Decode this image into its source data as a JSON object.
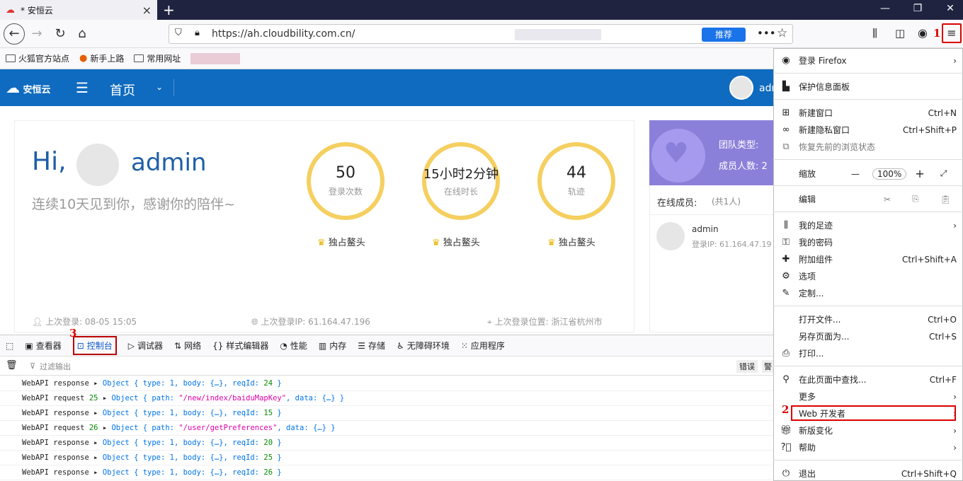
{
  "browser": {
    "tab_title": "* 安恒云",
    "url": "https://ah.cloudbility.com.cn/",
    "recommend_label": "推荐",
    "bookmarks": [
      "火狐官方站点",
      "新手上路",
      "常用网址"
    ]
  },
  "app": {
    "logo_text": "安恒云",
    "home_label": "首页",
    "top_user": "adr"
  },
  "dashboard": {
    "greeting": "Hi,",
    "username": "admin",
    "subline": "连续10天见到你，感谢你的陪伴~",
    "stats": [
      {
        "value": "50",
        "label": "登录次数",
        "badge": "独占鳌头"
      },
      {
        "value": "15小时2分钟",
        "label": "在线时长",
        "badge": "独占鳌头"
      },
      {
        "value": "44",
        "label": "轨迹",
        "badge": "独占鳌头"
      }
    ],
    "last_login": "上次登录:  08-05 15:05",
    "last_ip": "上次登录IP:  61.164.47.196",
    "last_location": "上次登录位置:  浙江省杭州市"
  },
  "team": {
    "type_label": "团队类型:",
    "members_label": "成员人数: 2",
    "online_label": "在线成员:",
    "online_count": "(共1人)",
    "member_name": "admin",
    "member_ip": "登录IP:  61.164.47.19"
  },
  "devtools": {
    "tabs": [
      "查看器",
      "控制台",
      "调试器",
      "网络",
      "样式编辑器",
      "性能",
      "内存",
      "存储",
      "无障碍环境",
      "应用程序"
    ],
    "filter_placeholder": "过滤输出",
    "filter_right": "错误",
    "filter_right2": "警",
    "logs": [
      {
        "kind": "WebAPI response",
        "n": "",
        "obj": "Object { type: 1, body: {…}, reqId: ",
        "id": "24",
        "tail": " }"
      },
      {
        "kind": "WebAPI request",
        "n": "25",
        "obj": "Object { path: ",
        "str": "\"/new/index/baiduMapKey\"",
        "tail": ", data: {…} }"
      },
      {
        "kind": "WebAPI response",
        "n": "",
        "obj": "Object { type: 1, body: {…}, reqId: ",
        "id": "15",
        "tail": " }"
      },
      {
        "kind": "WebAPI request",
        "n": "26",
        "obj": "Object { path: ",
        "str": "\"/user/getPreferences\"",
        "tail": ", data: {…} }"
      },
      {
        "kind": "WebAPI response",
        "n": "",
        "obj": "Object { type: 1, body: {…}, reqId: ",
        "id": "20",
        "tail": " }"
      },
      {
        "kind": "WebAPI response",
        "n": "",
        "obj": "Object { type: 1, body: {…}, reqId: ",
        "id": "25",
        "tail": " }"
      },
      {
        "kind": "WebAPI response",
        "n": "",
        "obj": "Object { type: 1, body: {…}, reqId: ",
        "id": "26",
        "tail": " }"
      }
    ]
  },
  "menu": {
    "signin": "登录 Firefox",
    "protection": "保护信息面板",
    "new_window": "新建窗口",
    "new_window_sc": "Ctrl+N",
    "private_window": "新建隐私窗口",
    "private_window_sc": "Ctrl+Shift+P",
    "restore": "恢复先前的浏览状态",
    "zoom": "缩放",
    "zoom_value": "100%",
    "edit": "编辑",
    "library": "我的足迹",
    "passwords": "我的密码",
    "addons": "附加组件",
    "addons_sc": "Ctrl+Shift+A",
    "options": "选项",
    "customize": "定制...",
    "open_file": "打开文件...",
    "open_file_sc": "Ctrl+O",
    "save_as": "另存页面为...",
    "save_as_sc": "Ctrl+S",
    "print": "打印...",
    "find": "在此页面中查找...",
    "find_sc": "Ctrl+F",
    "more": "更多",
    "webdev": "Web 开发者",
    "whats_new": "新版变化",
    "help": "帮助",
    "quit": "退出",
    "quit_sc": "Ctrl+Shift+Q"
  },
  "annotations": {
    "step1": "1",
    "step2": "2",
    "step3": "3"
  }
}
